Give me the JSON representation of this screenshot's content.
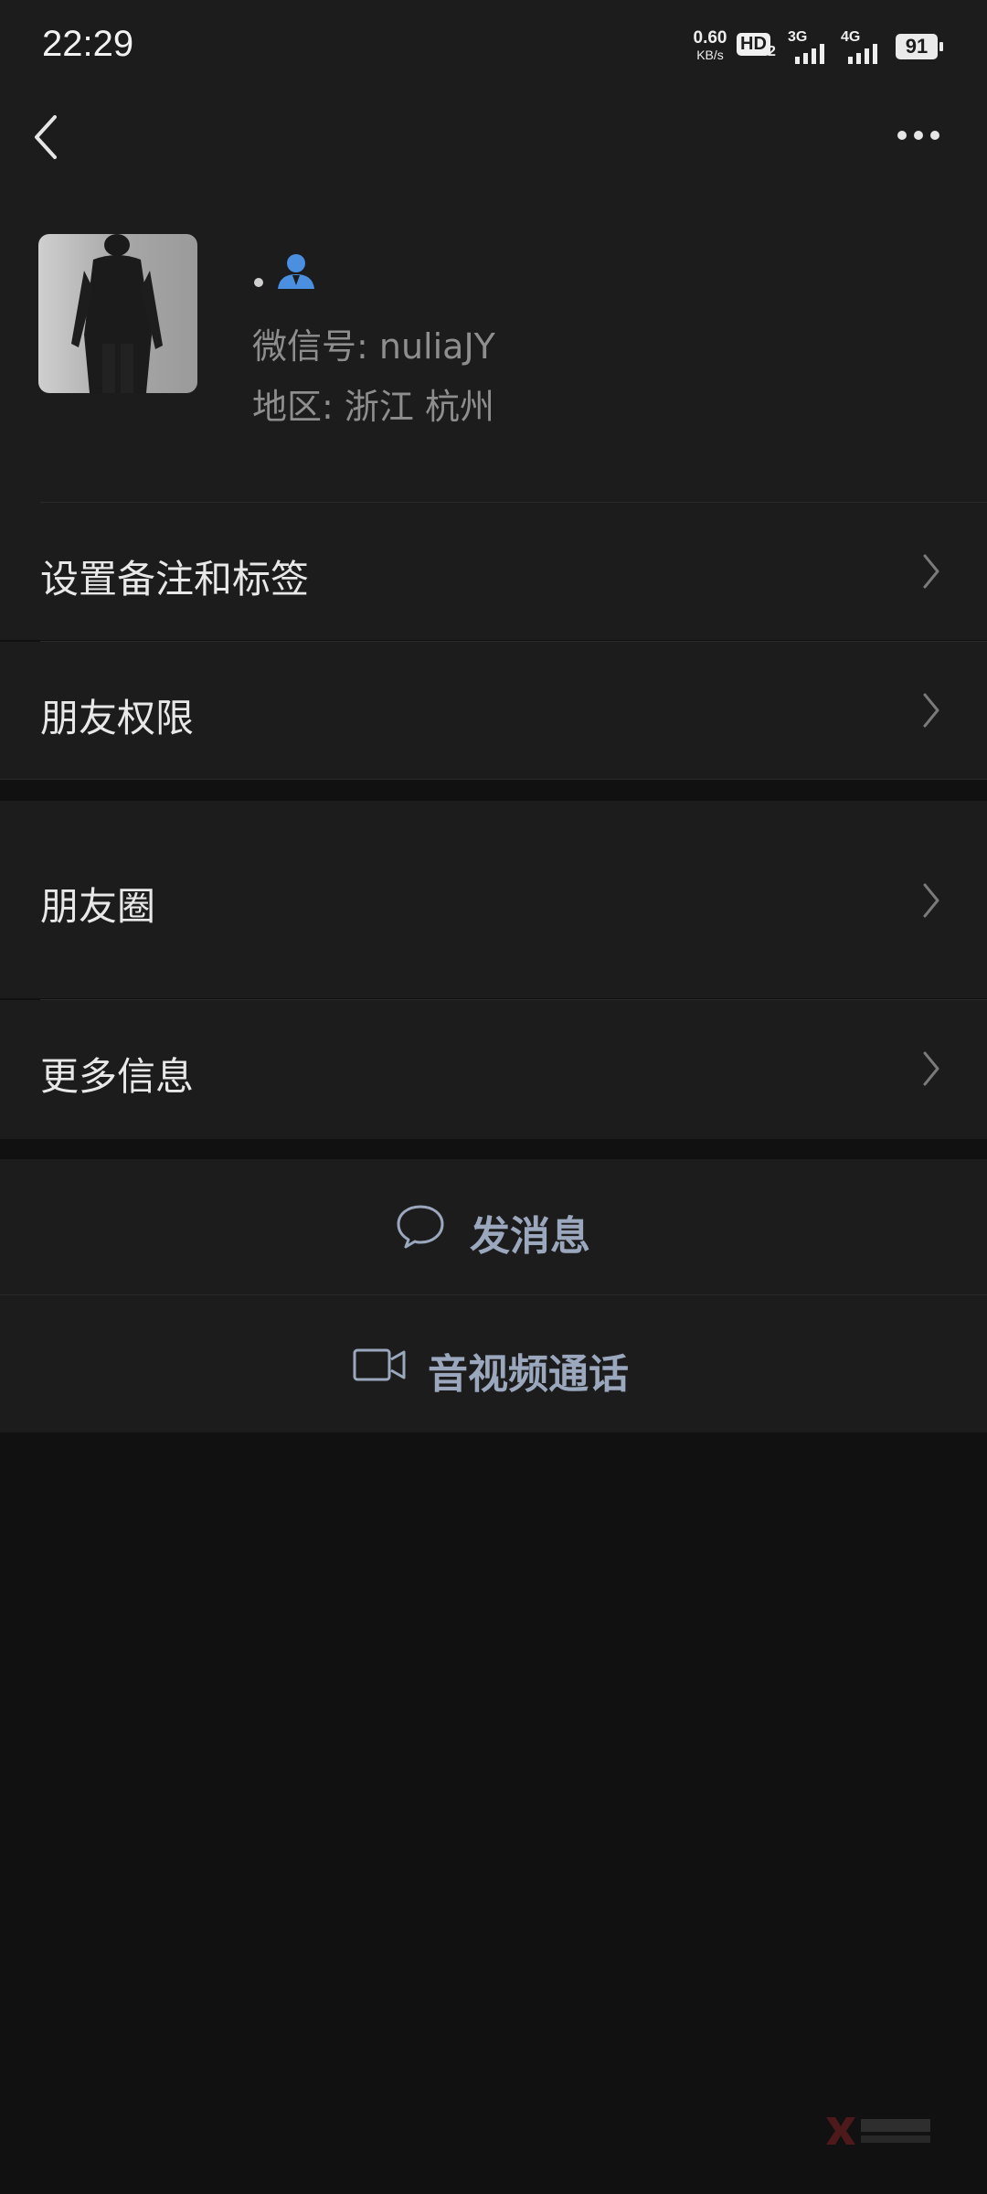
{
  "status_bar": {
    "time": "22:29",
    "net_speed_value": "0.60",
    "net_speed_unit": "KB/s",
    "hd_label": "HD",
    "hd_sub": "2",
    "signal_1_label": "3G",
    "signal_2_label": "4G",
    "battery_level": "91"
  },
  "profile": {
    "wechat_id_line": "微信号: nuliaJY",
    "region_line": "地区: 浙江  杭州"
  },
  "menu": {
    "remark_tags": "设置备注和标签",
    "friend_permissions": "朋友权限",
    "moments": "朋友圈",
    "more_info": "更多信息"
  },
  "actions": {
    "send_message": "发消息",
    "video_call": "音视频通话"
  },
  "colors": {
    "accent_icon": "#4a8fe0",
    "action_text": "#9aa7bd"
  }
}
